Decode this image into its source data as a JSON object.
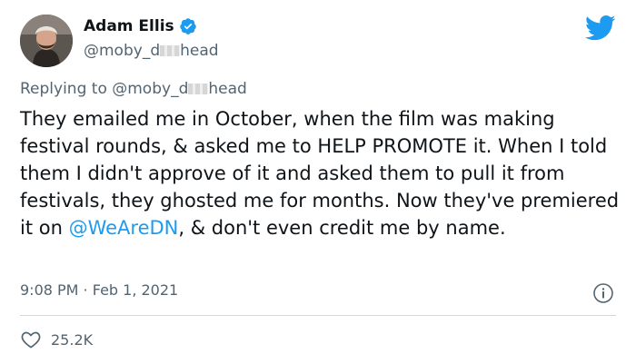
{
  "author": {
    "display_name": "Adam Ellis",
    "handle_prefix": "@moby_d",
    "handle_suffix": "head",
    "avatar_icon": "user-avatar",
    "verified_icon": "verified-badge-icon"
  },
  "reply": {
    "label": "Replying to",
    "handle_prefix": "@moby_d",
    "handle_suffix": "head"
  },
  "tweet": {
    "text_part1": "They emailed me in October, when the film was making festival rounds, & asked me to HELP PROMOTE it. When I told them I didn't approve of it and asked them to pull it from festivals, they ghosted me for months. Now they've premiered it on ",
    "mention": "@WeAreDN",
    "text_part2": ", & don't even credit me by name."
  },
  "meta": {
    "time": "9:08 PM",
    "separator": " · ",
    "date": "Feb 1, 2021"
  },
  "stats": {
    "likes": "25.2K"
  },
  "colors": {
    "accent": "#1d9bf0",
    "secondary_text": "#536471",
    "primary_text": "#0f1419",
    "divider": "#cfd9de"
  },
  "icons": {
    "brand": "twitter-bird-icon",
    "info": "info-icon",
    "like": "heart-icon"
  }
}
